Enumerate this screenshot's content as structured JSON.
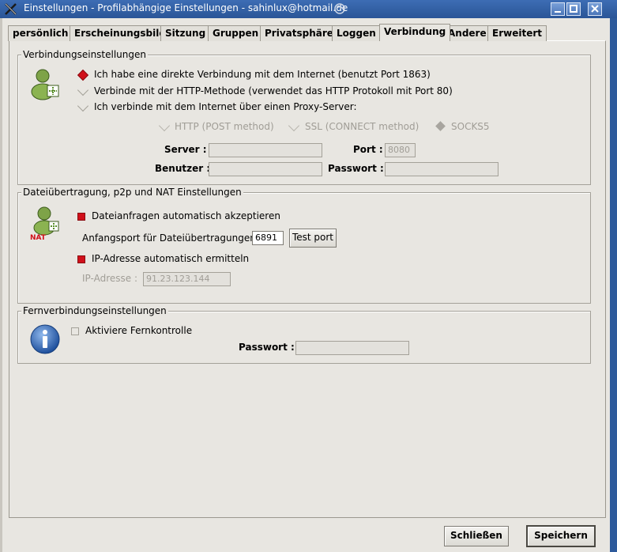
{
  "window": {
    "title": "Einstellungen - Profilabhängige Einstellungen - sahinlux@hotmail.de",
    "app_icon": "amsn-x-icon",
    "controls": [
      "minimize",
      "maximize",
      "close"
    ]
  },
  "tabs": [
    {
      "label": "persönlich",
      "active": false
    },
    {
      "label": "Erscheinungsbild",
      "active": false
    },
    {
      "label": "Sitzung",
      "active": false
    },
    {
      "label": "Gruppen",
      "active": false
    },
    {
      "label": "Privatsphäre",
      "active": false
    },
    {
      "label": "Loggen",
      "active": false
    },
    {
      "label": "Verbindung",
      "active": true
    },
    {
      "label": "Andere",
      "active": false
    },
    {
      "label": "Erweitert",
      "active": false
    }
  ],
  "connection": {
    "legend": "Verbindungseinstellungen",
    "icon": "msn-user-connection-icon",
    "options": [
      {
        "label": "Ich habe eine direkte Verbindung mit dem Internet (benutzt Port 1863)",
        "selected": true
      },
      {
        "label": "Verbinde mit der HTTP-Methode (verwendet das HTTP Protokoll mit Port 80)",
        "selected": false
      },
      {
        "label": "Ich verbinde mit dem Internet über einen Proxy-Server:",
        "selected": false
      }
    ],
    "proxy_types": [
      {
        "label": "HTTP (POST method)",
        "selected": false
      },
      {
        "label": "SSL (CONNECT method)",
        "selected": false
      },
      {
        "label": "SOCKS5",
        "selected": true
      }
    ],
    "server_label": "Server :",
    "server_value": "",
    "port_label": "Port :",
    "port_value": "8080",
    "user_label": "Benutzer :",
    "user_value": "",
    "password_label": "Passwort :",
    "password_value": ""
  },
  "filetransfer": {
    "legend": "Dateiübertragung, p2p und NAT Einstellungen",
    "icon": "msn-user-nat-icon",
    "icon_text": "NAT",
    "auto_accept_label": "Dateianfragen automatisch akzeptieren",
    "auto_accept": true,
    "start_port_label": "Anfangsport für Dateiübertragungen :",
    "start_port_value": "6891",
    "test_port_button": "Test port",
    "auto_ip_label": "IP-Adresse automatisch ermitteln",
    "auto_ip": true,
    "ip_label": "IP-Adresse :",
    "ip_value": "91.23.123.144"
  },
  "remote": {
    "legend": "Fernverbindungseinstellungen",
    "icon": "info-icon",
    "enable_label": "Aktiviere Fernkontrolle",
    "enabled": false,
    "password_label": "Passwort :",
    "password_value": ""
  },
  "footer": {
    "close_button": "Schließen",
    "save_button": "Speichern"
  },
  "colors": {
    "titlebar": "#2a5597",
    "accent_red": "#d0101a",
    "background": "#e8e6e1"
  }
}
